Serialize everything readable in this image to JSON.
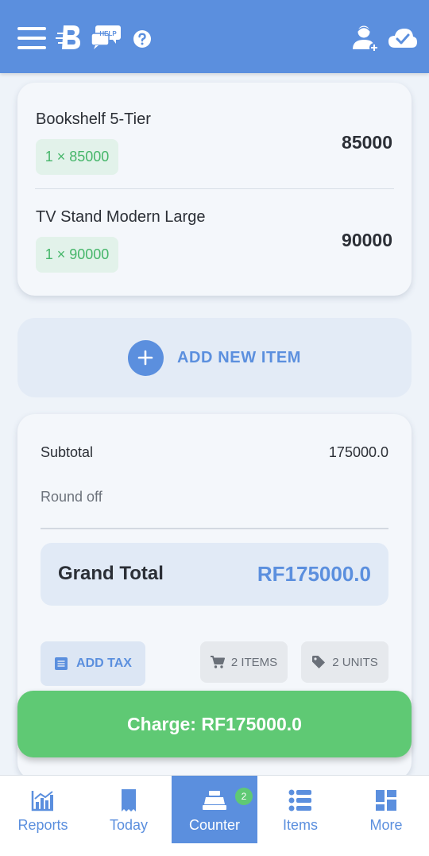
{
  "header": {
    "icons": [
      "menu-icon",
      "app-logo-icon",
      "help-icon",
      "question-icon",
      "add-user-icon",
      "cloud-sync-icon"
    ],
    "help_text": "HELP"
  },
  "colors": {
    "primary": "#5b8fde",
    "success": "#5fc974",
    "pill_bg": "#e2f2ea",
    "pill_text": "#46b66a"
  },
  "items": [
    {
      "name": "Bookshelf 5-Tier",
      "qty_price": "1 × 85000",
      "amount": "85000"
    },
    {
      "name": "TV Stand Modern Large",
      "qty_price": "1 × 90000",
      "amount": "90000"
    }
  ],
  "add_item": {
    "label": "ADD NEW ITEM"
  },
  "summary": {
    "subtotal_label": "Subtotal",
    "subtotal_value": "175000.0",
    "roundoff_label": "Round off",
    "grand_label": "Grand Total",
    "grand_value": "RF175000.0",
    "add_tax_label": "ADD TAX",
    "items_count": "2 ITEMS",
    "units_count": "2 UNITS"
  },
  "charge": {
    "label": "Charge: RF175000.0"
  },
  "nav": {
    "items": [
      {
        "label": "Reports",
        "icon": "reports-chart-icon",
        "active": false
      },
      {
        "label": "Today",
        "icon": "receipt-icon",
        "active": false
      },
      {
        "label": "Counter",
        "icon": "cash-register-icon",
        "active": true,
        "badge": "2"
      },
      {
        "label": "Items",
        "icon": "list-icon",
        "active": false
      },
      {
        "label": "More",
        "icon": "grid-icon",
        "active": false
      }
    ]
  }
}
